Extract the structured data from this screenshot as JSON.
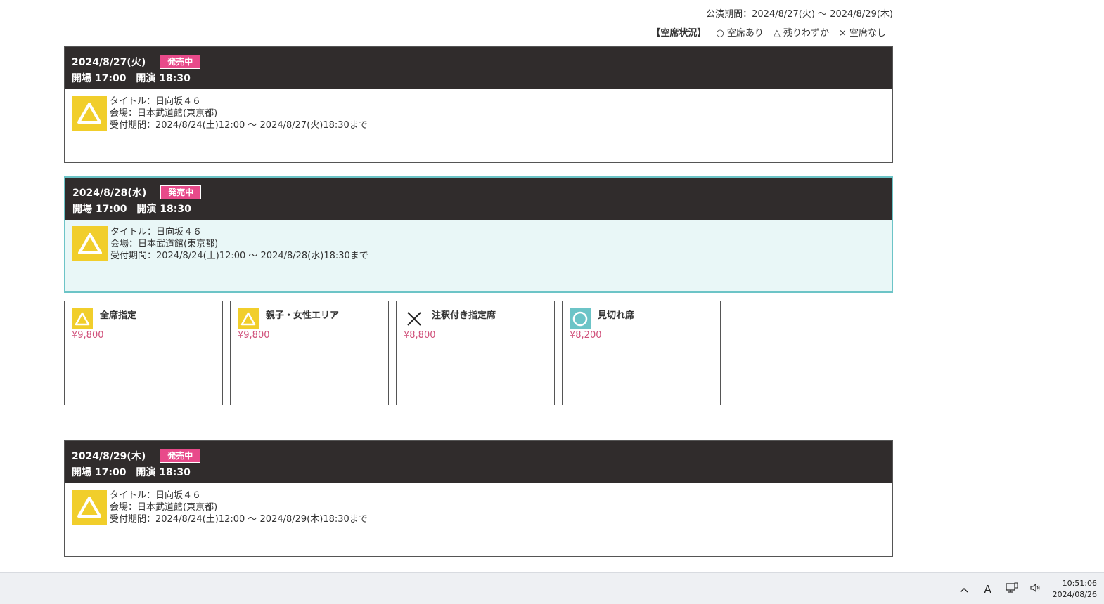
{
  "header": {
    "period": "公演期間：2024/8/27(火) 〜 2024/8/29(木)",
    "legend_title": "【空席状況】",
    "legend_items": [
      "○ 空席あり",
      "△ 残りわずか",
      "× 空席なし"
    ]
  },
  "performances": [
    {
      "date": "2024/8/27(火)",
      "badge": "発売中",
      "times": "開場 17:00　開演 18:30",
      "status_icon": "triangle-icon",
      "title": "タイトル：日向坂４６",
      "venue": "会場：日本武道館(東京都)",
      "reception": "受付期間：2024/8/24(土)12:00 〜 2024/8/27(火)18:30まで"
    },
    {
      "date": "2024/8/28(水)",
      "badge": "発売中",
      "times": "開場 17:00　開演 18:30",
      "status_icon": "triangle-icon",
      "title": "タイトル：日向坂４６",
      "venue": "会場：日本武道館(東京都)",
      "reception": "受付期間：2024/8/24(土)12:00 〜 2024/8/28(水)18:30まで"
    },
    {
      "date": "2024/8/29(木)",
      "badge": "発売中",
      "times": "開場 17:00　開演 18:30",
      "status_icon": "triangle-icon",
      "title": "タイトル：日向坂４６",
      "venue": "会場：日本武道館(東京都)",
      "reception": "受付期間：2024/8/24(土)12:00 〜 2024/8/29(木)18:30まで"
    }
  ],
  "seats": [
    {
      "name": "全席指定",
      "price": "¥9,800",
      "status_icon": "triangle-icon"
    },
    {
      "name": "親子・女性エリア",
      "price": "¥9,800",
      "status_icon": "triangle-icon"
    },
    {
      "name": "注釈付き指定席",
      "price": "¥8,800",
      "status_icon": "cross-icon"
    },
    {
      "name": "見切れ席",
      "price": "¥8,200",
      "status_icon": "circle-icon"
    }
  ],
  "taskbar": {
    "time": "10:51:06",
    "date": "2024/08/26",
    "ime": "A"
  },
  "colors": {
    "header_bg": "#302c2c",
    "badge": "#e84a8a",
    "triangle_status": "#f1ce2b",
    "circle_status": "#6cc4c7",
    "price": "#d0507a",
    "selected_bg": "#e9f7f7"
  }
}
